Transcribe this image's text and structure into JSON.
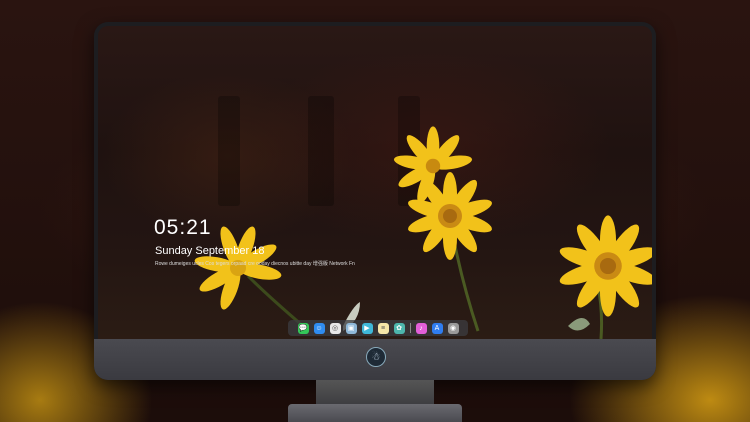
{
  "lockscreen": {
    "time": "05:21",
    "date": "Sunday September 18",
    "subtitle": "Rowe dumeiges ucles Cos tegers orpaad cre ooday diecnos ubitte day 增强版 Network Fn"
  },
  "dock": {
    "apps": [
      {
        "name": "messages-icon",
        "glyph": "💬",
        "color": "#34c759"
      },
      {
        "name": "finder-icon",
        "glyph": "☺",
        "color": "#2f8cf0"
      },
      {
        "name": "safari-icon",
        "glyph": "◎",
        "color": "#e8e8e8"
      },
      {
        "name": "preview-icon",
        "glyph": "▣",
        "color": "#8fb8d8"
      },
      {
        "name": "video-icon",
        "glyph": "▶",
        "color": "#3fb8d8"
      },
      {
        "name": "notes-icon",
        "glyph": "≡",
        "color": "#f5e6a8"
      },
      {
        "name": "photos-icon",
        "glyph": "✿",
        "color": "#4db6ac"
      },
      {
        "name": "music-icon",
        "glyph": "♪",
        "color": "#e25fd8"
      },
      {
        "name": "app-store-icon",
        "glyph": "A",
        "color": "#2f7df0"
      },
      {
        "name": "camera-icon",
        "glyph": "◉",
        "color": "#9a9a9a"
      }
    ]
  },
  "monitor": {
    "logo_glyph": "☃"
  }
}
